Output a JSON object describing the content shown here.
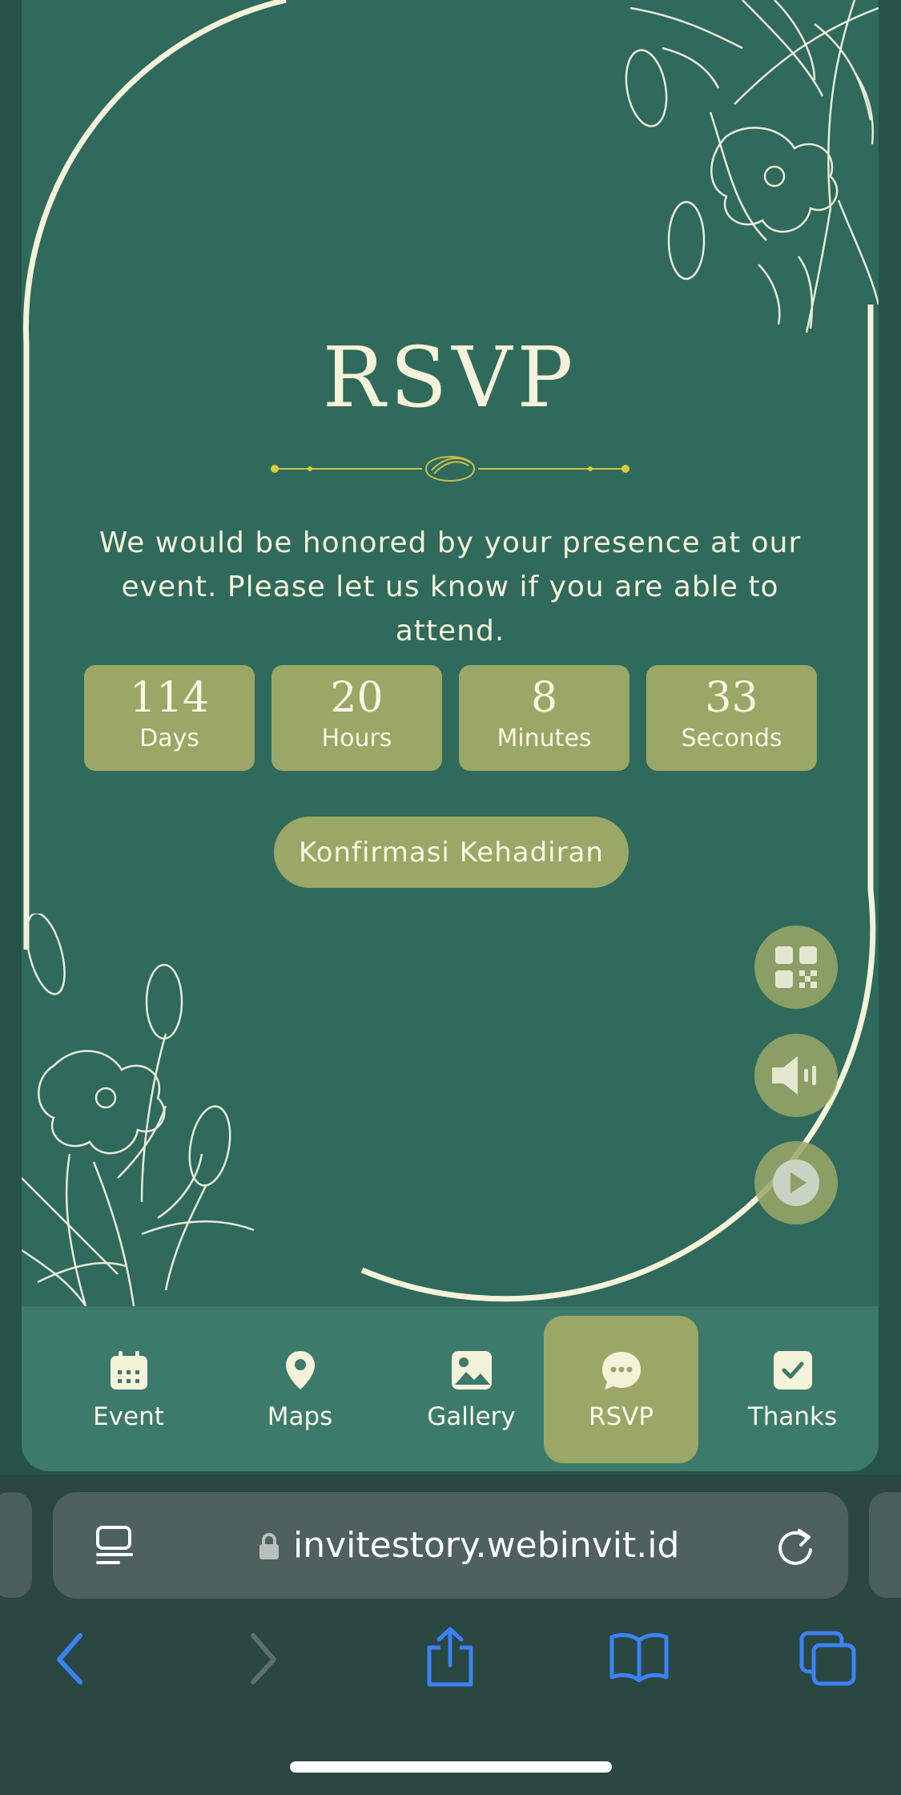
{
  "section": {
    "title": "RSVP",
    "message": "We would be honored by your presence at our event. Please let us know if you are able to attend."
  },
  "countdown": [
    {
      "value": "114",
      "label": "Days"
    },
    {
      "value": "20",
      "label": "Hours"
    },
    {
      "value": "8",
      "label": "Minutes"
    },
    {
      "value": "33",
      "label": "Seconds"
    }
  ],
  "confirm_button": {
    "label": "Konfirmasi Kehadiran"
  },
  "floating_buttons": [
    "qr-code-icon",
    "speaker-icon",
    "play-icon"
  ],
  "nav": {
    "items": [
      {
        "label": "Event",
        "icon": "calendar-icon"
      },
      {
        "label": "Maps",
        "icon": "map-pin-icon"
      },
      {
        "label": "Gallery",
        "icon": "image-icon"
      },
      {
        "label": "RSVP",
        "icon": "chat-icon",
        "active": true
      },
      {
        "label": "Thanks",
        "icon": "check-icon"
      }
    ]
  },
  "browser": {
    "url": "invitestory.webinvit.id"
  },
  "colors": {
    "background": "#2f6a5c",
    "accent": "#9aa766",
    "text": "#f4f2d9",
    "nav": "#3c7a6c",
    "browser_chrome": "#2b4741",
    "link_blue": "#3b82f6"
  }
}
